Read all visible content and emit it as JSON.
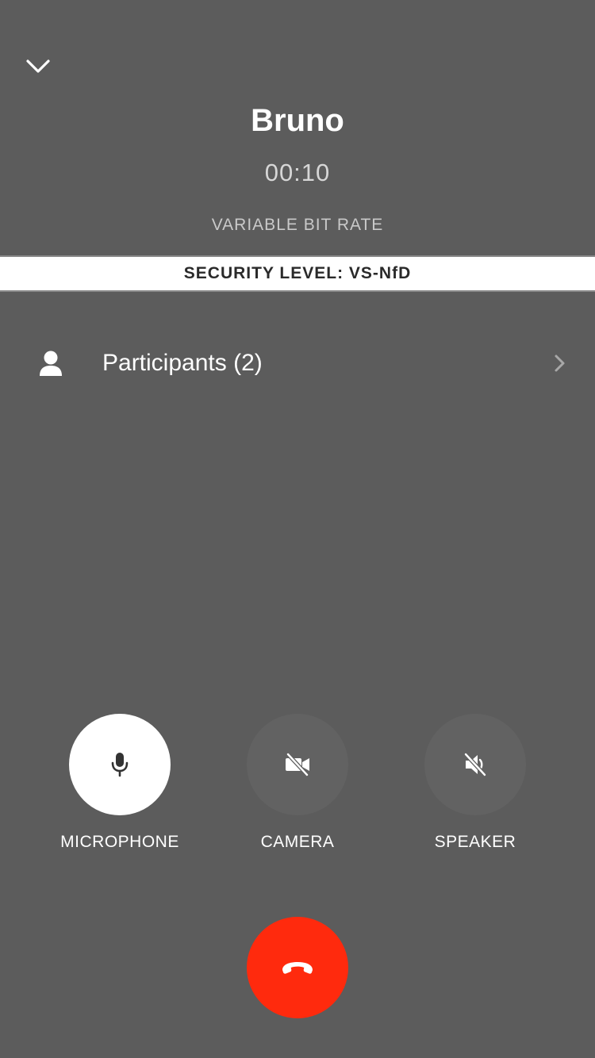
{
  "header": {
    "collapse_icon": "chevron-down-icon"
  },
  "call": {
    "name": "Bruno",
    "timer": "00:10",
    "bitrate": "VARIABLE BIT RATE"
  },
  "security": {
    "text": "SECURITY LEVEL: VS-NfD"
  },
  "participants": {
    "label": "Participants (2)",
    "icon": "person-icon",
    "chevron": "chevron-right-icon"
  },
  "controls": {
    "microphone": {
      "label": "MICROPHONE",
      "icon": "microphone-icon",
      "state": "on"
    },
    "camera": {
      "label": "CAMERA",
      "icon": "camera-off-icon",
      "state": "off"
    },
    "speaker": {
      "label": "SPEAKER",
      "icon": "speaker-muted-icon",
      "state": "off"
    }
  },
  "hangup": {
    "icon": "hang-up-icon"
  },
  "colors": {
    "background": "#5c5c5c",
    "hangup": "#ff2a0d",
    "banner": "#ffffff",
    "control_inactive": "#626262"
  }
}
